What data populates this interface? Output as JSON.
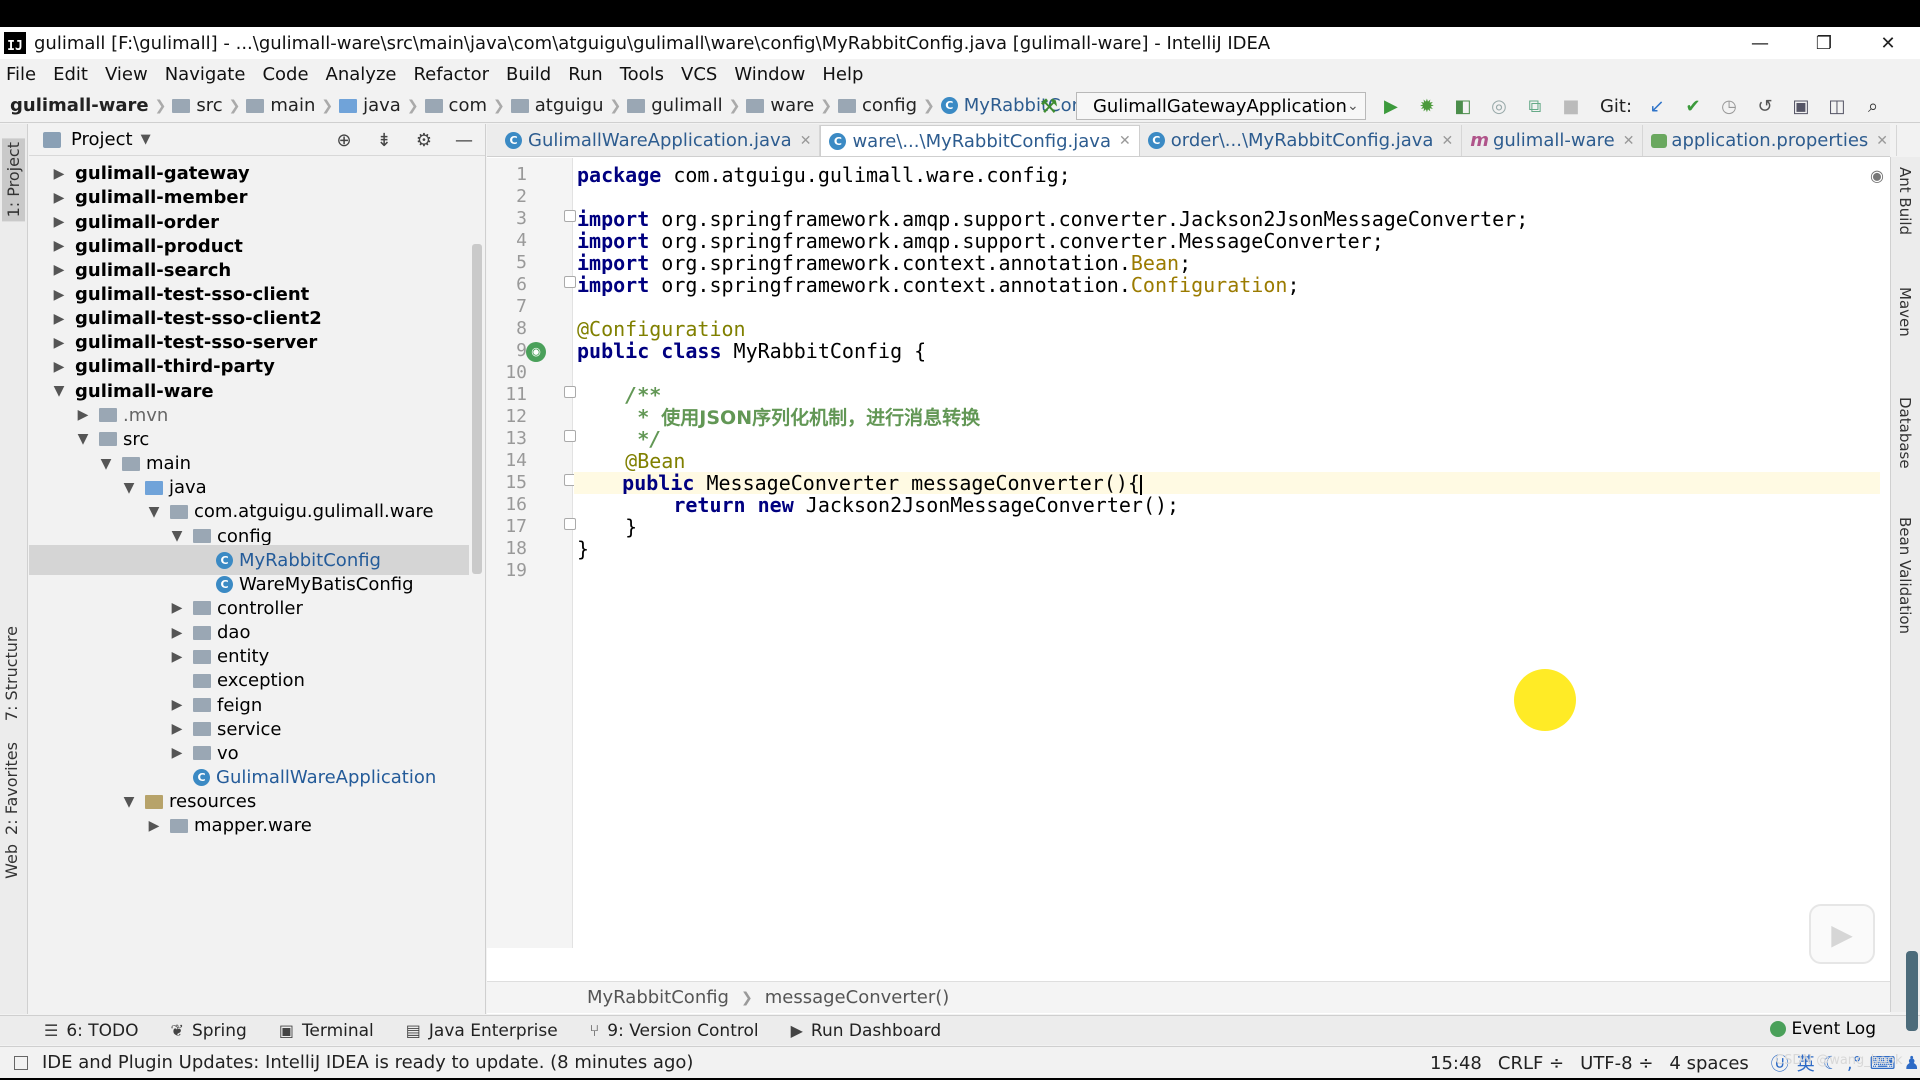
{
  "window": {
    "title": "gulimall [F:\\gulimall] - ...\\gulimall-ware\\src\\main\\java\\com\\atguigu\\gulimall\\ware\\config\\MyRabbitConfig.java [gulimall-ware] - IntelliJ IDEA",
    "logo": "IJ",
    "minimize": "—",
    "restore": "❐",
    "close": "✕"
  },
  "menu": [
    "File",
    "Edit",
    "View",
    "Navigate",
    "Code",
    "Analyze",
    "Refactor",
    "Build",
    "Run",
    "Tools",
    "VCS",
    "Window",
    "Help"
  ],
  "navbar": {
    "crumbs": [
      "gulimall-ware",
      "src",
      "main",
      "java",
      "com",
      "atguigu",
      "gulimall",
      "ware",
      "config",
      "MyRabbitConfig"
    ],
    "run_config": "GulimallGatewayApplication",
    "git_label": "Git:"
  },
  "left_strip": {
    "project": "1: Project",
    "structure": "7: Structure",
    "favorites": "2: Favorites",
    "web": "Web"
  },
  "right_strip": {
    "ant": "Ant Build",
    "maven": "Maven",
    "database": "Database",
    "bean": "Bean Validation"
  },
  "project_panel": {
    "title": "Project",
    "items": [
      {
        "label": "gulimall-gateway",
        "depth": 0,
        "toggle": "▶",
        "kind": "module"
      },
      {
        "label": "gulimall-member",
        "depth": 0,
        "toggle": "▶",
        "kind": "module"
      },
      {
        "label": "gulimall-order",
        "depth": 0,
        "toggle": "▶",
        "kind": "module"
      },
      {
        "label": "gulimall-product",
        "depth": 0,
        "toggle": "▶",
        "kind": "module"
      },
      {
        "label": "gulimall-search",
        "depth": 0,
        "toggle": "▶",
        "kind": "module"
      },
      {
        "label": "gulimall-test-sso-client",
        "depth": 0,
        "toggle": "▶",
        "kind": "module"
      },
      {
        "label": "gulimall-test-sso-client2",
        "depth": 0,
        "toggle": "▶",
        "kind": "module"
      },
      {
        "label": "gulimall-test-sso-server",
        "depth": 0,
        "toggle": "▶",
        "kind": "module"
      },
      {
        "label": "gulimall-third-party",
        "depth": 0,
        "toggle": "▶",
        "kind": "module"
      },
      {
        "label": "gulimall-ware",
        "depth": 0,
        "toggle": "▼",
        "kind": "module"
      },
      {
        "label": ".mvn",
        "depth": 1,
        "toggle": "▶",
        "kind": "folder-gray"
      },
      {
        "label": "src",
        "depth": 1,
        "toggle": "▼",
        "kind": "folder"
      },
      {
        "label": "main",
        "depth": 2,
        "toggle": "▼",
        "kind": "folder"
      },
      {
        "label": "java",
        "depth": 3,
        "toggle": "▼",
        "kind": "folder-src"
      },
      {
        "label": "com.atguigu.gulimall.ware",
        "depth": 4,
        "toggle": "▼",
        "kind": "folder"
      },
      {
        "label": "config",
        "depth": 5,
        "toggle": "▼",
        "kind": "folder"
      },
      {
        "label": "MyRabbitConfig",
        "depth": 6,
        "toggle": "",
        "kind": "class-selected"
      },
      {
        "label": "WareMyBatisConfig",
        "depth": 6,
        "toggle": "",
        "kind": "class"
      },
      {
        "label": "controller",
        "depth": 5,
        "toggle": "▶",
        "kind": "folder"
      },
      {
        "label": "dao",
        "depth": 5,
        "toggle": "▶",
        "kind": "folder"
      },
      {
        "label": "entity",
        "depth": 5,
        "toggle": "▶",
        "kind": "folder"
      },
      {
        "label": "exception",
        "depth": 5,
        "toggle": "",
        "kind": "folder"
      },
      {
        "label": "feign",
        "depth": 5,
        "toggle": "▶",
        "kind": "folder"
      },
      {
        "label": "service",
        "depth": 5,
        "toggle": "▶",
        "kind": "folder"
      },
      {
        "label": "vo",
        "depth": 5,
        "toggle": "▶",
        "kind": "folder"
      },
      {
        "label": "GulimallWareApplication",
        "depth": 5,
        "toggle": "",
        "kind": "class-app"
      },
      {
        "label": "resources",
        "depth": 3,
        "toggle": "▼",
        "kind": "folder-res"
      },
      {
        "label": "mapper.ware",
        "depth": 4,
        "toggle": "▶",
        "kind": "folder"
      }
    ]
  },
  "tabs": [
    {
      "label": "GulimallWareApplication.java",
      "icon": "C",
      "active": false
    },
    {
      "label": "ware\\...\\MyRabbitConfig.java",
      "icon": "C",
      "active": true
    },
    {
      "label": "order\\...\\MyRabbitConfig.java",
      "icon": "C",
      "active": false
    },
    {
      "label": "gulimall-ware",
      "icon": "m",
      "active": false
    },
    {
      "label": "application.properties",
      "icon": "p",
      "active": false
    }
  ],
  "code": {
    "line_numbers": [
      "1",
      "2",
      "3",
      "4",
      "5",
      "6",
      "7",
      "8",
      "9",
      "10",
      "11",
      "12",
      "13",
      "14",
      "15",
      "16",
      "17",
      "18",
      "19"
    ],
    "l1_kw": "package",
    "l1_rest": " com.atguigu.gulimall.ware.config;",
    "l3_kw": "import",
    "l3_rest": " org.springframework.amqp.support.converter.Jackson2JsonMessageConverter;",
    "l4_kw": "import",
    "l4_rest": " org.springframework.amqp.support.converter.MessageConverter;",
    "l5_kw": "import",
    "l5_rest": " org.springframework.context.annotation.",
    "l5_ref": "Bean",
    "l5_end": ";",
    "l6_kw": "import",
    "l6_rest": " org.springframework.context.annotation.",
    "l6_ref": "Configuration",
    "l6_end": ";",
    "l8_ann": "@Configuration",
    "l9_kw1": "public",
    "l9_kw2": "class",
    "l9_rest": " MyRabbitConfig {",
    "l11_cm": "    /**",
    "l12_star": "     * ",
    "l12_text": "使用JSON序列化机制，进行消息转换",
    "l13_cm": "     */",
    "l14_ann": "    @Bean",
    "l15_indent": "    ",
    "l15_kw": "public",
    "l15_rest": " MessageConverter messageConverter(){",
    "l16_indent": "        ",
    "l16_kw1": "return",
    "l16_kw2": "new",
    "l16_rest": " Jackson2JsonMessageConverter();",
    "l17": "    }",
    "l18": "}"
  },
  "editor_breadcrumb": [
    "MyRabbitConfig",
    "messageConverter()"
  ],
  "tool_windows": [
    "6: TODO",
    "Spring",
    "Terminal",
    "Java Enterprise",
    "9: Version Control",
    "Run Dashboard"
  ],
  "event_log": "Event Log",
  "status": {
    "message": "IDE and Plugin Updates: IntelliJ IDEA is ready to update. (8 minutes ago)",
    "position": "15:48",
    "line_sep": "CRLF ÷",
    "encoding": "UTF-8 ÷",
    "indent": "4 spaces",
    "ime": "英"
  },
  "watermark": "CSDN @wang_book"
}
